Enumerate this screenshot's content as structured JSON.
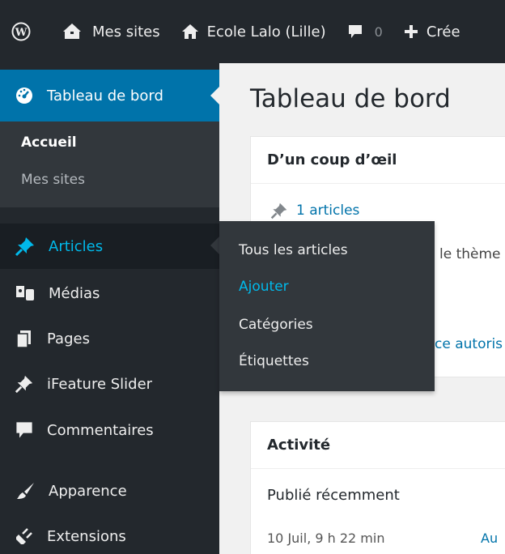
{
  "adminbar": {
    "mysites_label": "Mes sites",
    "site_label": "Ecole Lalo (Lille)",
    "comments_count": "0",
    "new_label": "Crée"
  },
  "sidebar": {
    "dashboard": "Tableau de bord",
    "dashboard_sub": [
      "Accueil",
      "Mes sites"
    ],
    "articles": "Articles",
    "medias": "Médias",
    "pages": "Pages",
    "ifeature": "iFeature Slider",
    "comments": "Commentaires",
    "appearance": "Apparence",
    "extensions": "Extensions"
  },
  "flyout": [
    "Tous les articles",
    "Ajouter",
    "Catégories",
    "Étiquettes"
  ],
  "main": {
    "title": "Tableau de bord",
    "glance": {
      "heading": "D’un coup d’œil",
      "articles_link": "1 articles",
      "theme_fragment": "le thème",
      "autoris_fragment": "ce autoris"
    },
    "activity": {
      "heading": "Activité",
      "recent": "Publié récemment",
      "date": "10 Juil, 9 h 22 min",
      "post_fragment": "Au"
    }
  },
  "colors": {
    "admin_dark": "#23282d",
    "accent_blue": "#0073aa",
    "submenu_bg": "#32373c",
    "highlight_cyan": "#00b9eb"
  }
}
